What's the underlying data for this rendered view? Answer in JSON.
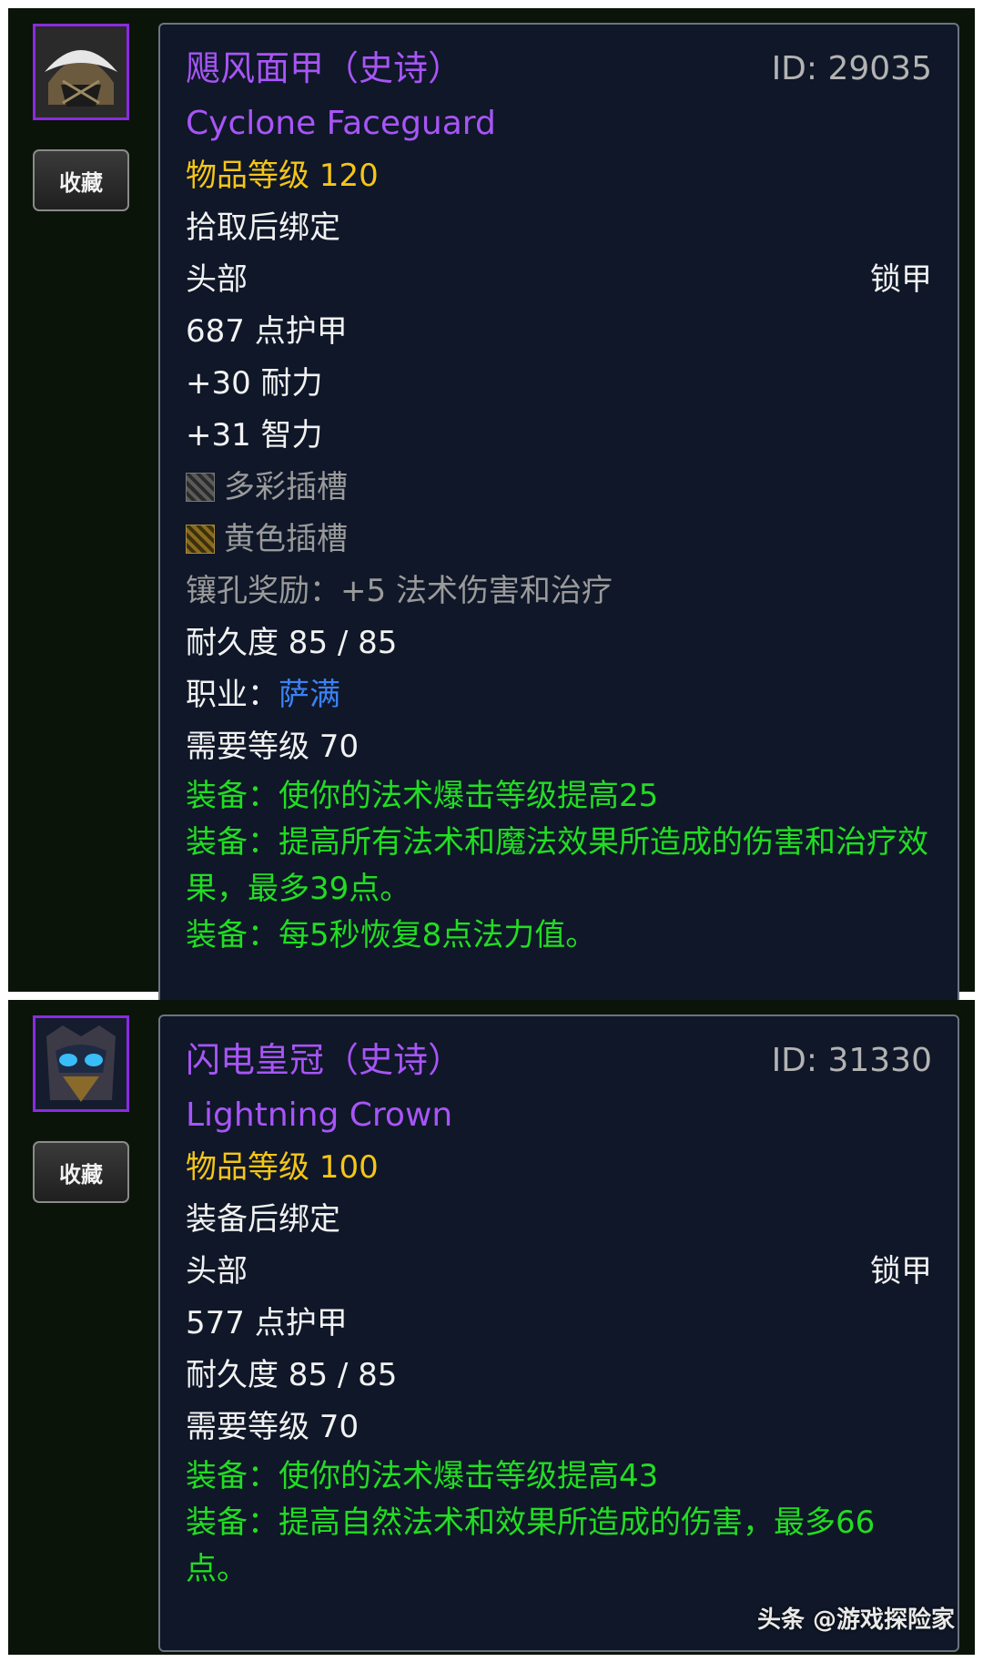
{
  "items": [
    {
      "favorite_label": "收藏",
      "title": "飓风面甲（史诗）",
      "id_text": "ID: 29035",
      "english_name": "Cyclone Faceguard",
      "item_level": "物品等级 120",
      "binding": "拾取后绑定",
      "slot": "头部",
      "armor_type": "锁甲",
      "armor": "687 点护甲",
      "stats": [
        "+30 耐力",
        "+31 智力"
      ],
      "sockets": [
        {
          "icon": "prismatic-socket-icon",
          "label": "多彩插槽"
        },
        {
          "icon": "yellow-socket-icon",
          "label": "黄色插槽"
        }
      ],
      "socket_bonus": "镶孔奖励：+5 法术伤害和治疗",
      "durability": "耐久度 85 / 85",
      "class_label": "职业：",
      "class_value": "萨满",
      "required_level": "需要等级 70",
      "equip_effects": [
        "装备：使你的法术爆击等级提高25",
        "装备：提高所有法术和魔法效果所造成的伤害和治疗效果，最多39点。",
        "装备：每5秒恢复8点法力值。"
      ]
    },
    {
      "favorite_label": "收藏",
      "title": "闪电皇冠（史诗）",
      "id_text": "ID: 31330",
      "english_name": "Lightning Crown",
      "item_level": "物品等级 100",
      "binding": "装备后绑定",
      "slot": "头部",
      "armor_type": "锁甲",
      "armor": "577 点护甲",
      "durability": "耐久度 85 / 85",
      "required_level": "需要等级 70",
      "equip_effects": [
        "装备：使你的法术爆击等级提高43",
        "装备：提高自然法术和效果所造成的伤害，最多66点。"
      ]
    }
  ],
  "watermark": "头条 @游戏探险家",
  "colors": {
    "epic": "#a855f7",
    "item_level": "#f5c518",
    "equip": "#22dd22",
    "class": "#3b82f6",
    "tooltip_bg": "#0f1728"
  }
}
